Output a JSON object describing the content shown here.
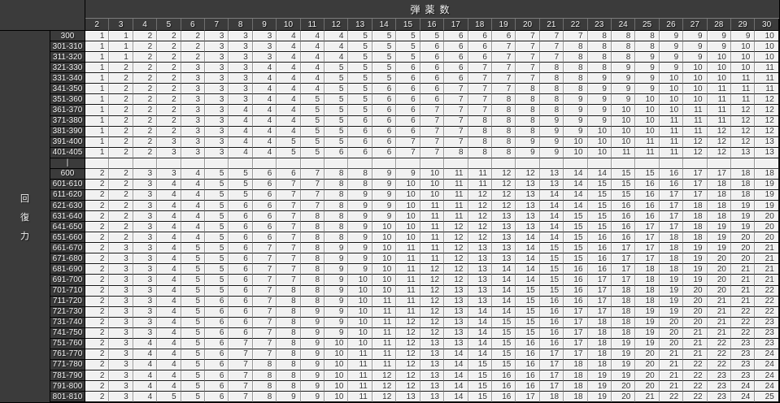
{
  "colors": {
    "header_bg": "#3b3b3b",
    "header_text": "#f2f2f2",
    "cell_bg": "#f1f1f1",
    "cell_text": "#333333",
    "border_dark": "#000000",
    "border_light": "#999999"
  },
  "chart_data": {
    "type": "table",
    "title": "弾薬数",
    "corner_label": "回復力",
    "col_headers": [
      "2",
      "3",
      "4",
      "5",
      "6",
      "7",
      "8",
      "9",
      "10",
      "11",
      "12",
      "13",
      "14",
      "15",
      "16",
      "17",
      "18",
      "19",
      "20",
      "21",
      "22",
      "23",
      "24",
      "25",
      "26",
      "27",
      "28",
      "29",
      "30"
    ],
    "rows": [
      {
        "label": "300",
        "values": [
          1,
          1,
          2,
          2,
          2,
          3,
          3,
          3,
          4,
          4,
          4,
          5,
          5,
          5,
          5,
          6,
          6,
          6,
          7,
          7,
          7,
          8,
          8,
          8,
          9,
          9,
          9,
          9,
          10
        ]
      },
      {
        "label": "301-310",
        "values": [
          1,
          1,
          2,
          2,
          2,
          3,
          3,
          3,
          4,
          4,
          4,
          5,
          5,
          5,
          6,
          6,
          6,
          7,
          7,
          7,
          8,
          8,
          8,
          8,
          9,
          9,
          9,
          10,
          10
        ]
      },
      {
        "label": "311-320",
        "values": [
          1,
          1,
          2,
          2,
          2,
          3,
          3,
          3,
          4,
          4,
          4,
          5,
          5,
          5,
          6,
          6,
          6,
          7,
          7,
          7,
          8,
          8,
          8,
          9,
          9,
          9,
          10,
          10,
          10
        ]
      },
      {
        "label": "321-330",
        "values": [
          1,
          2,
          2,
          2,
          3,
          3,
          3,
          4,
          4,
          4,
          5,
          5,
          5,
          6,
          6,
          6,
          7,
          7,
          7,
          8,
          8,
          8,
          9,
          9,
          9,
          10,
          10,
          10,
          11
        ]
      },
      {
        "label": "331-340",
        "values": [
          1,
          2,
          2,
          2,
          3,
          3,
          3,
          4,
          4,
          4,
          5,
          5,
          5,
          6,
          6,
          6,
          7,
          7,
          7,
          8,
          8,
          9,
          9,
          9,
          10,
          10,
          10,
          11,
          11
        ]
      },
      {
        "label": "341-350",
        "values": [
          1,
          2,
          2,
          2,
          3,
          3,
          3,
          4,
          4,
          4,
          5,
          5,
          6,
          6,
          6,
          7,
          7,
          7,
          8,
          8,
          8,
          9,
          9,
          9,
          10,
          10,
          11,
          11,
          11
        ]
      },
      {
        "label": "351-360",
        "values": [
          1,
          2,
          2,
          2,
          3,
          3,
          3,
          4,
          4,
          5,
          5,
          5,
          6,
          6,
          6,
          7,
          7,
          8,
          8,
          8,
          9,
          9,
          9,
          10,
          10,
          10,
          11,
          11,
          12
        ]
      },
      {
        "label": "361-370",
        "values": [
          1,
          2,
          2,
          2,
          3,
          3,
          4,
          4,
          4,
          5,
          5,
          5,
          6,
          6,
          7,
          7,
          7,
          8,
          8,
          8,
          9,
          9,
          10,
          10,
          10,
          11,
          11,
          12,
          12
        ]
      },
      {
        "label": "371-380",
        "values": [
          1,
          2,
          2,
          2,
          3,
          3,
          4,
          4,
          4,
          5,
          5,
          6,
          6,
          6,
          7,
          7,
          8,
          8,
          8,
          9,
          9,
          9,
          10,
          10,
          11,
          11,
          11,
          12,
          12
        ]
      },
      {
        "label": "381-390",
        "values": [
          1,
          2,
          2,
          2,
          3,
          3,
          4,
          4,
          4,
          5,
          5,
          6,
          6,
          6,
          7,
          7,
          8,
          8,
          8,
          9,
          9,
          10,
          10,
          10,
          11,
          11,
          12,
          12,
          12
        ]
      },
      {
        "label": "391-400",
        "values": [
          1,
          2,
          2,
          3,
          3,
          3,
          4,
          4,
          5,
          5,
          5,
          6,
          6,
          7,
          7,
          7,
          8,
          8,
          9,
          9,
          10,
          10,
          10,
          11,
          11,
          12,
          12,
          12,
          13
        ]
      },
      {
        "label": "401-405",
        "values": [
          1,
          2,
          2,
          3,
          3,
          3,
          4,
          4,
          5,
          5,
          6,
          6,
          6,
          7,
          7,
          8,
          8,
          8,
          9,
          9,
          10,
          10,
          11,
          11,
          11,
          12,
          12,
          13,
          13
        ]
      },
      {
        "label": "|",
        "values": []
      },
      {
        "label": "600",
        "values": [
          2,
          2,
          3,
          3,
          4,
          5,
          5,
          6,
          6,
          7,
          8,
          8,
          9,
          9,
          10,
          11,
          11,
          12,
          12,
          13,
          14,
          14,
          15,
          15,
          16,
          17,
          17,
          18,
          18
        ]
      },
      {
        "label": "601-610",
        "values": [
          2,
          2,
          3,
          4,
          4,
          5,
          5,
          6,
          7,
          7,
          8,
          8,
          9,
          10,
          10,
          11,
          11,
          12,
          13,
          13,
          14,
          15,
          15,
          16,
          16,
          17,
          18,
          18,
          19
        ]
      },
      {
        "label": "611-620",
        "values": [
          2,
          2,
          3,
          4,
          4,
          5,
          5,
          6,
          7,
          7,
          8,
          9,
          9,
          10,
          10,
          11,
          12,
          12,
          13,
          14,
          14,
          15,
          15,
          16,
          17,
          17,
          18,
          18,
          19
        ]
      },
      {
        "label": "621-630",
        "values": [
          2,
          2,
          3,
          4,
          4,
          5,
          6,
          6,
          7,
          7,
          8,
          9,
          9,
          10,
          11,
          11,
          12,
          12,
          13,
          14,
          14,
          15,
          16,
          16,
          17,
          18,
          18,
          19,
          19
        ]
      },
      {
        "label": "631-640",
        "values": [
          2,
          2,
          3,
          4,
          4,
          5,
          6,
          6,
          7,
          8,
          8,
          9,
          9,
          10,
          11,
          11,
          12,
          13,
          13,
          14,
          15,
          15,
          16,
          16,
          17,
          18,
          18,
          19,
          20
        ]
      },
      {
        "label": "641-650",
        "values": [
          2,
          2,
          3,
          4,
          4,
          5,
          6,
          6,
          7,
          8,
          8,
          9,
          10,
          10,
          11,
          12,
          12,
          13,
          13,
          14,
          15,
          15,
          16,
          17,
          17,
          18,
          19,
          19,
          20
        ]
      },
      {
        "label": "651-660",
        "values": [
          2,
          2,
          3,
          4,
          4,
          5,
          6,
          6,
          7,
          8,
          8,
          9,
          10,
          10,
          11,
          12,
          12,
          13,
          14,
          14,
          15,
          16,
          16,
          17,
          18,
          18,
          19,
          20,
          20
        ]
      },
      {
        "label": "661-670",
        "values": [
          2,
          3,
          3,
          4,
          5,
          5,
          6,
          7,
          7,
          8,
          9,
          9,
          10,
          11,
          11,
          12,
          13,
          13,
          14,
          15,
          15,
          16,
          17,
          17,
          18,
          19,
          19,
          20,
          21
        ]
      },
      {
        "label": "671-680",
        "values": [
          2,
          3,
          3,
          4,
          5,
          5,
          6,
          7,
          7,
          8,
          9,
          9,
          10,
          11,
          11,
          12,
          13,
          13,
          14,
          15,
          15,
          16,
          17,
          17,
          18,
          19,
          20,
          20,
          21
        ]
      },
      {
        "label": "681-690",
        "values": [
          2,
          3,
          3,
          4,
          5,
          5,
          6,
          7,
          7,
          8,
          9,
          9,
          10,
          11,
          12,
          12,
          13,
          14,
          14,
          15,
          16,
          16,
          17,
          18,
          18,
          19,
          20,
          21,
          21
        ]
      },
      {
        "label": "691-700",
        "values": [
          2,
          3,
          3,
          4,
          5,
          5,
          6,
          7,
          7,
          8,
          9,
          10,
          10,
          11,
          12,
          12,
          13,
          14,
          14,
          15,
          16,
          17,
          17,
          18,
          19,
          19,
          20,
          21,
          21
        ]
      },
      {
        "label": "701-710",
        "values": [
          2,
          3,
          3,
          4,
          5,
          5,
          6,
          7,
          8,
          8,
          9,
          10,
          10,
          11,
          12,
          13,
          13,
          14,
          15,
          15,
          16,
          17,
          18,
          18,
          19,
          20,
          20,
          21,
          22
        ]
      },
      {
        "label": "711-720",
        "values": [
          2,
          3,
          3,
          4,
          5,
          6,
          6,
          7,
          8,
          8,
          9,
          10,
          11,
          11,
          12,
          13,
          13,
          14,
          15,
          16,
          16,
          17,
          18,
          18,
          19,
          20,
          21,
          21,
          22
        ]
      },
      {
        "label": "721-730",
        "values": [
          2,
          3,
          3,
          4,
          5,
          6,
          6,
          7,
          8,
          9,
          9,
          10,
          11,
          11,
          12,
          13,
          14,
          14,
          15,
          16,
          17,
          17,
          18,
          19,
          19,
          20,
          21,
          22,
          22
        ]
      },
      {
        "label": "731-740",
        "values": [
          2,
          3,
          3,
          4,
          5,
          6,
          6,
          7,
          8,
          9,
          9,
          10,
          11,
          12,
          12,
          13,
          14,
          15,
          15,
          16,
          17,
          18,
          18,
          19,
          20,
          20,
          21,
          22,
          23
        ]
      },
      {
        "label": "741-750",
        "values": [
          2,
          3,
          3,
          4,
          5,
          6,
          6,
          7,
          8,
          9,
          9,
          10,
          11,
          12,
          12,
          13,
          14,
          15,
          15,
          16,
          17,
          18,
          18,
          19,
          20,
          21,
          21,
          22,
          23
        ]
      },
      {
        "label": "751-760",
        "values": [
          2,
          3,
          4,
          4,
          5,
          6,
          7,
          7,
          8,
          9,
          10,
          10,
          11,
          12,
          13,
          13,
          14,
          15,
          16,
          16,
          17,
          18,
          19,
          19,
          20,
          21,
          22,
          23,
          23
        ]
      },
      {
        "label": "761-770",
        "values": [
          2,
          3,
          4,
          4,
          5,
          6,
          7,
          7,
          8,
          9,
          10,
          11,
          11,
          12,
          13,
          14,
          14,
          15,
          16,
          17,
          17,
          18,
          19,
          20,
          21,
          21,
          22,
          23,
          24
        ]
      },
      {
        "label": "771-780",
        "values": [
          2,
          3,
          4,
          4,
          5,
          6,
          7,
          8,
          8,
          9,
          10,
          11,
          11,
          12,
          13,
          14,
          15,
          15,
          16,
          17,
          18,
          18,
          19,
          20,
          21,
          22,
          22,
          23,
          24
        ]
      },
      {
        "label": "781-790",
        "values": [
          2,
          3,
          4,
          4,
          5,
          6,
          7,
          8,
          8,
          9,
          10,
          11,
          12,
          12,
          13,
          14,
          15,
          16,
          16,
          17,
          18,
          19,
          19,
          20,
          21,
          22,
          23,
          23,
          24
        ]
      },
      {
        "label": "791-800",
        "values": [
          2,
          3,
          4,
          4,
          5,
          6,
          7,
          8,
          8,
          9,
          10,
          11,
          12,
          12,
          13,
          14,
          15,
          16,
          16,
          17,
          18,
          19,
          20,
          20,
          21,
          22,
          23,
          24,
          24
        ]
      },
      {
        "label": "801-810",
        "values": [
          2,
          3,
          4,
          5,
          5,
          6,
          7,
          8,
          9,
          9,
          10,
          11,
          12,
          13,
          13,
          14,
          15,
          16,
          17,
          18,
          18,
          19,
          20,
          21,
          22,
          22,
          23,
          24,
          25
        ]
      }
    ]
  }
}
